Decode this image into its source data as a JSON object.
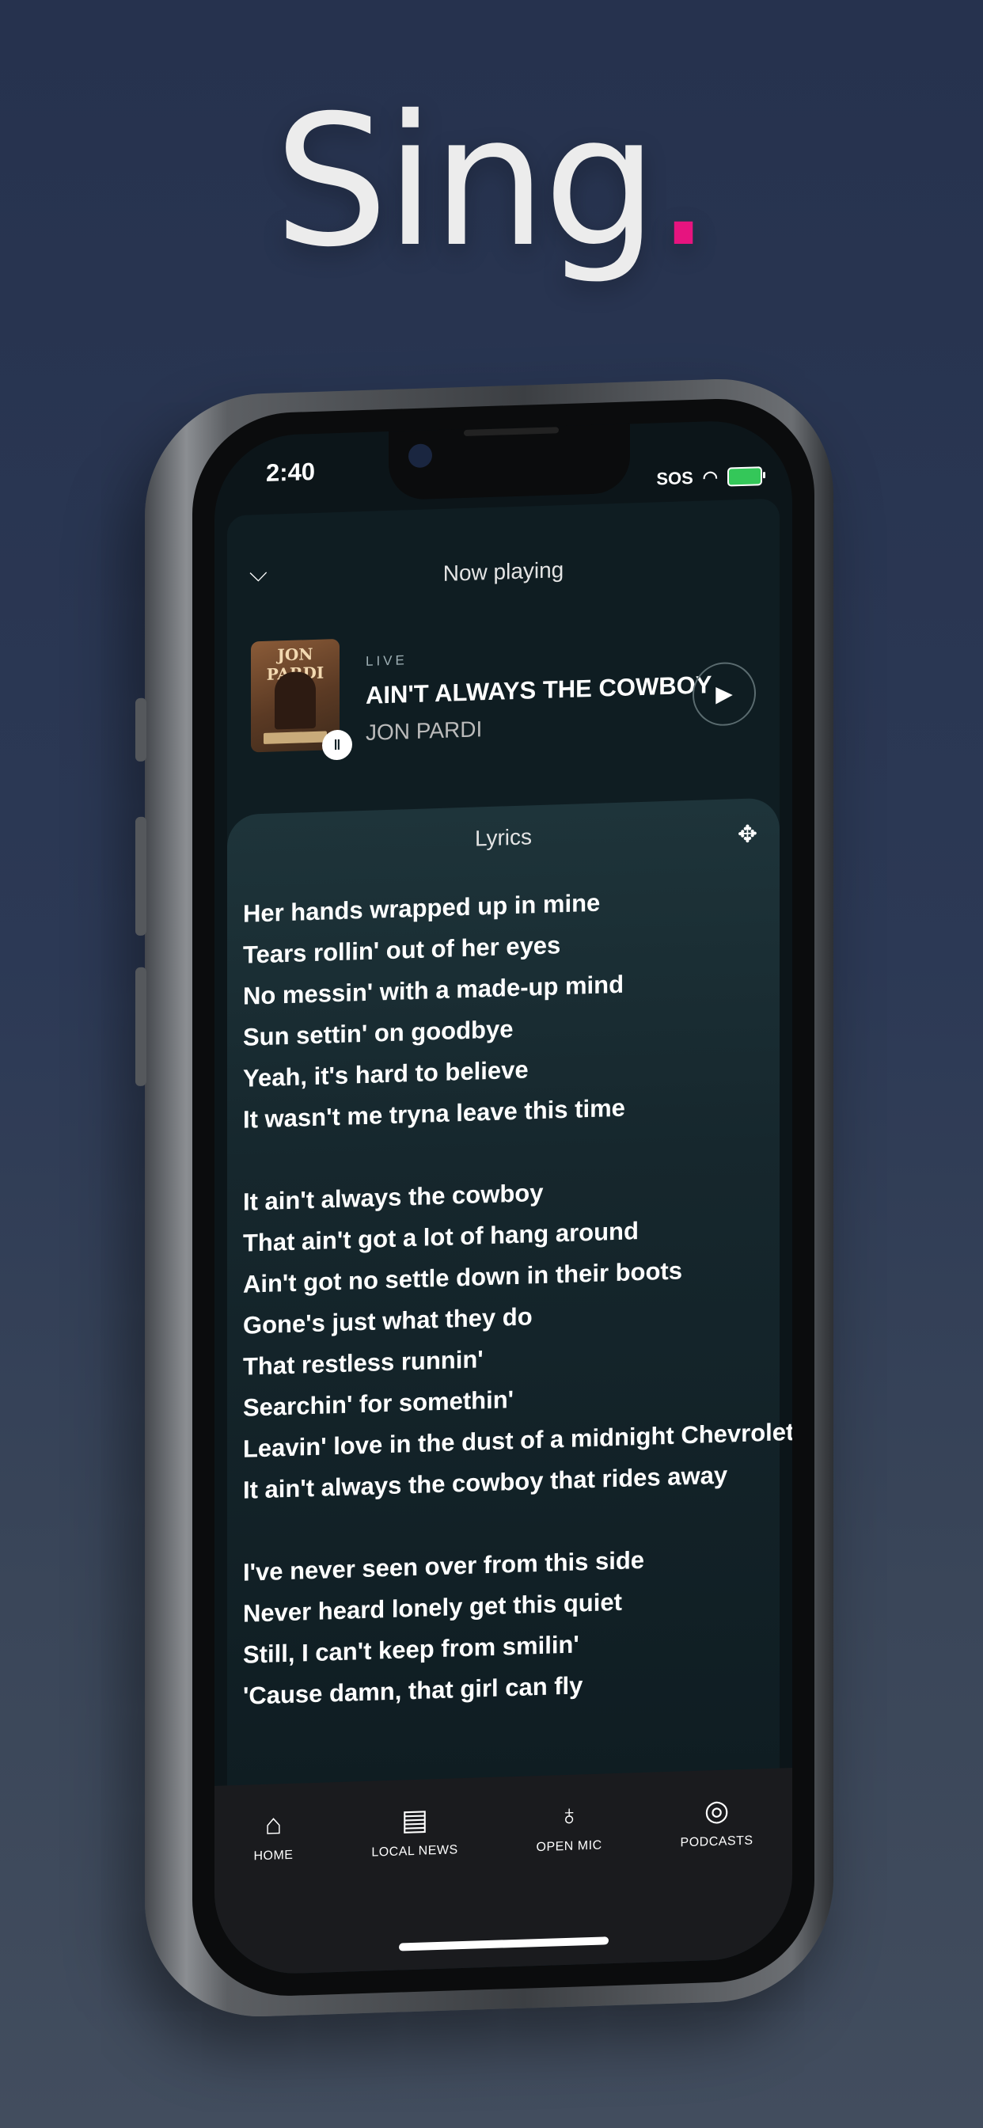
{
  "headline": {
    "text": "Sing",
    "dot": "."
  },
  "status_bar": {
    "time": "2:40",
    "sos": "SOS",
    "wifi_icon": "wifi-icon",
    "battery_icon": "battery-charging-icon"
  },
  "header": {
    "collapse_icon": "chevron-down-icon",
    "title": "Now playing"
  },
  "track": {
    "badge": "LIVE",
    "title": "AIN'T ALWAYS THE COWBOY",
    "artist": "JON PARDI",
    "album_art_text": "JON PARDI",
    "audio_icon": "audio-wave-icon",
    "play_icon": "play-icon"
  },
  "lyrics": {
    "title": "Lyrics",
    "expand_icon": "expand-icon",
    "verses": [
      [
        "Her hands wrapped up in mine",
        "Tears rollin' out of her eyes",
        "No messin' with a made-up mind",
        "Sun settin' on goodbye",
        "Yeah, it's hard to believe",
        "It wasn't me tryna leave this time"
      ],
      [
        "It ain't always the cowboy",
        "That ain't got a lot of hang around",
        "Ain't got no settle down in their boots",
        "Gone's just what they do",
        "That restless runnin'",
        "Searchin' for somethin'",
        "Leavin' love in the dust of a midnight Chevrolet",
        "It ain't always the cowboy that rides away"
      ],
      [
        "I've never seen over from this side",
        "Never heard lonely get this quiet",
        "Still, I can't keep from smilin'",
        "'Cause damn, that girl can fly"
      ]
    ]
  },
  "nav": [
    {
      "label": "HOME",
      "icon": "home-icon"
    },
    {
      "label": "LOCAL NEWS",
      "icon": "newspaper-icon"
    },
    {
      "label": "OPEN MIC",
      "icon": "microphone-icon"
    },
    {
      "label": "PODCASTS",
      "icon": "podcast-icon"
    }
  ],
  "colors": {
    "accent": "#e6147f",
    "background": "#2c3955",
    "screen": "#0c1519"
  }
}
